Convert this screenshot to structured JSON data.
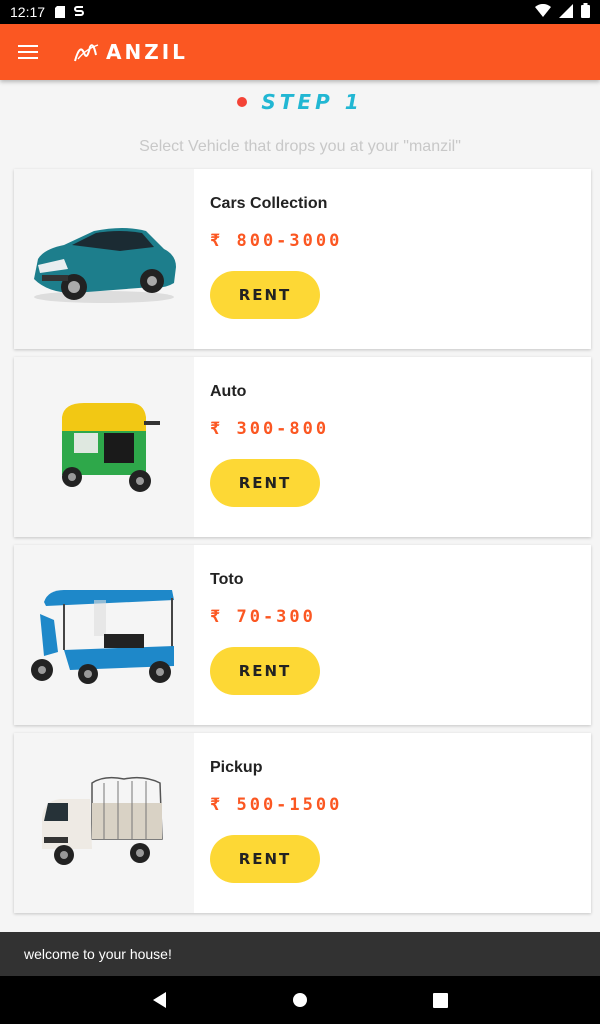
{
  "status_bar": {
    "time": "12:17"
  },
  "app_bar": {
    "brand": "ANZIL"
  },
  "step": {
    "label": "STEP 1"
  },
  "subtitle": "Select Vehicle that drops you at your \"manzil\"",
  "vehicles": [
    {
      "name": "Cars Collection",
      "price": "₹ 800-3000",
      "button": "RENT",
      "icon": "car-image"
    },
    {
      "name": "Auto",
      "price": "₹ 300-800",
      "button": "RENT",
      "icon": "auto-rickshaw-image"
    },
    {
      "name": "Toto",
      "price": "₹ 70-300",
      "button": "RENT",
      "icon": "e-rickshaw-image"
    },
    {
      "name": "Pickup",
      "price": "₹ 500-1500",
      "button": "RENT",
      "icon": "pickup-truck-image"
    }
  ],
  "snackbar": "welcome to your house!",
  "colors": {
    "primary": "#fb5722",
    "accent": "#fdd835",
    "step": "#22b7d3",
    "dot": "#f44336"
  }
}
